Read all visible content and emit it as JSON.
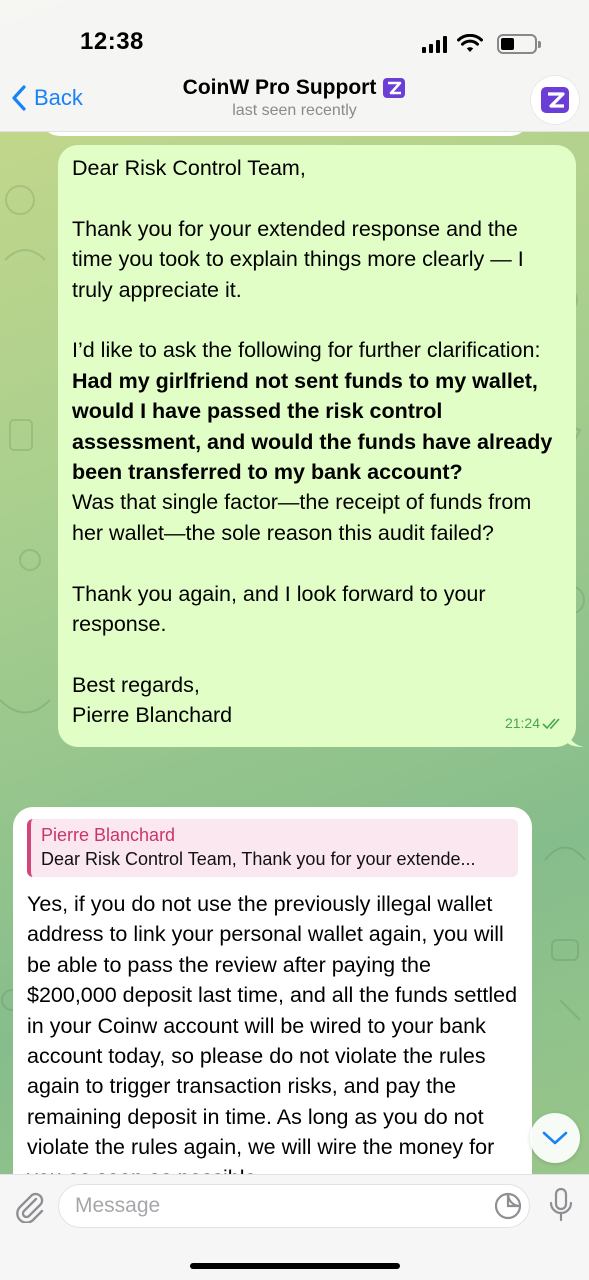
{
  "status_bar": {
    "time": "12:38"
  },
  "nav": {
    "back_label": "Back",
    "title": "CoinW Pro Support",
    "subtitle": "last seen recently"
  },
  "messages": {
    "outgoing": {
      "greeting": "Dear Risk Control Team,",
      "para1": "Thank you for your extended response and the time you took to explain things more clearly — I truly appreciate it.",
      "para2_intro": "I’d like to ask the following for further clarification:",
      "para2_bold": "Had my girlfriend not sent funds to my wallet, would I have passed the risk control assessment, and would the funds have already been transferred to my bank account?",
      "para2_rest": "Was that single factor—the receipt of funds from her wallet—the sole reason this audit failed?",
      "para3": "Thank you again, and I look forward to your response.",
      "signoff": "Best regards,",
      "signature": "Pierre Blanchard",
      "time": "21:24"
    },
    "incoming": {
      "reply_name": "Pierre Blanchard",
      "reply_text": "Dear Risk Control Team, Thank you for your extende...",
      "body": "Yes, if you do not use the previously illegal wallet address to link your personal wallet again, you will be able to pass the review after paying the $200,000 deposit last time, and all the funds settled in your Coinw account will be wired to your bank account today, so please do not violate the rules again to trigger transaction risks, and pay the remaining deposit in time. As long as you do not violate the rules again, we will wire the money for you as soon as possible."
    }
  },
  "input": {
    "placeholder": "Message"
  },
  "colors": {
    "accent": "#1a82f7",
    "outgoing_bubble": "#e1fec6",
    "reply_accent": "#d4457a",
    "check": "#4aa54c",
    "badge": "#6b3fd6"
  },
  "icons": [
    "back-chevron-icon",
    "verified-badge-icon",
    "coinw-logo-icon",
    "double-check-icon",
    "chevron-down-icon",
    "attach-icon",
    "sticker-icon",
    "mic-icon"
  ]
}
